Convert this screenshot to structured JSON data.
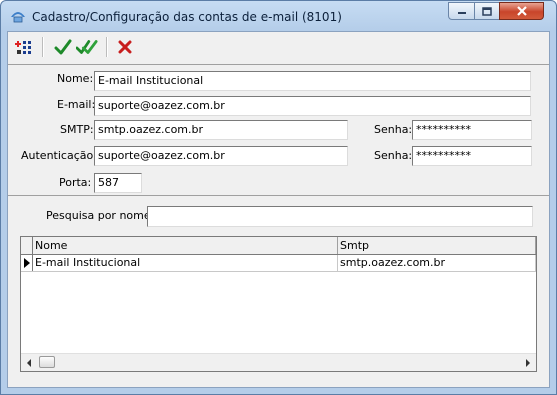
{
  "window": {
    "title": "Cadastro/Configuração das contas de e-mail (8101)",
    "close_color": "#c9452b"
  },
  "toolbar": {
    "buttons": [
      {
        "icon": "add-record-icon"
      },
      {
        "icon": "checkmark-icon"
      },
      {
        "icon": "double-checkmark-icon"
      },
      {
        "icon": "red-x-icon"
      }
    ]
  },
  "form": {
    "nome_label": "Nome:",
    "nome_value": "E-mail Institucional",
    "email_label": "E-mail:",
    "email_value": "suporte@oazez.com.br",
    "smtp_label": "SMTP:",
    "smtp_value": "smtp.oazez.com.br",
    "senha1_label": "Senha:",
    "senha1_value": "**********",
    "auth_label": "Autenticação:",
    "auth_value": "suporte@oazez.com.br",
    "senha2_label": "Senha:",
    "senha2_value": "**********",
    "porta_label": "Porta:",
    "porta_value": "587"
  },
  "search": {
    "label": "Pesquisa por nome:",
    "value": ""
  },
  "grid": {
    "columns": [
      "Nome",
      "Smtp"
    ],
    "rows": [
      {
        "nome": "E-mail Institucional",
        "smtp": "smtp.oazez.com.br"
      }
    ]
  }
}
